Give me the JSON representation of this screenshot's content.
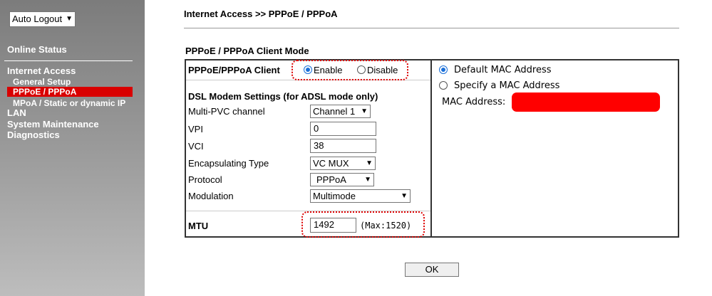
{
  "sidebar": {
    "logout_select": "Auto Logout",
    "online_status": "Online Status",
    "internet_access": "Internet Access",
    "general_setup": "General Setup",
    "pppoe_pppoa": "PPPoE / PPPoA",
    "mpoa": "MPoA / Static or dynamic IP",
    "lan": "LAN",
    "system_maintenance": "System Maintenance",
    "diagnostics": "Diagnostics"
  },
  "breadcrumb": "Internet Access >> PPPoE / PPPoA",
  "section_title": "PPPoE / PPPoA Client Mode",
  "left_panel": {
    "client_label": "PPPoE/PPPoA Client",
    "enable_label": "Enable",
    "disable_label": "Disable",
    "client_state": "enable",
    "dsl_heading": "DSL Modem Settings (for ADSL mode only)",
    "multi_pvc_label": "Multi-PVC channel",
    "multi_pvc_value": "Channel 1",
    "vpi_label": "VPI",
    "vpi_value": "0",
    "vci_label": "VCI",
    "vci_value": "38",
    "encap_label": "Encapsulating Type",
    "encap_value": "VC MUX",
    "protocol_label": "Protocol",
    "protocol_value": "PPPoA",
    "modulation_label": "Modulation",
    "modulation_value": "Multimode",
    "mtu_label": "MTU",
    "mtu_value": "1492",
    "mtu_max": "(Max:1520)"
  },
  "right_panel": {
    "default_mac_label": "Default MAC Address",
    "specify_mac_label": "Specify a MAC Address",
    "mac_address_label": "MAC Address:",
    "mac_selected": "default"
  },
  "ok_button": "OK",
  "colors": {
    "sidebar_active": "#d90000",
    "redaction": "#ff0000",
    "highlight_dotted": "#dd0000",
    "radio_selected": "#1a6fd8"
  }
}
